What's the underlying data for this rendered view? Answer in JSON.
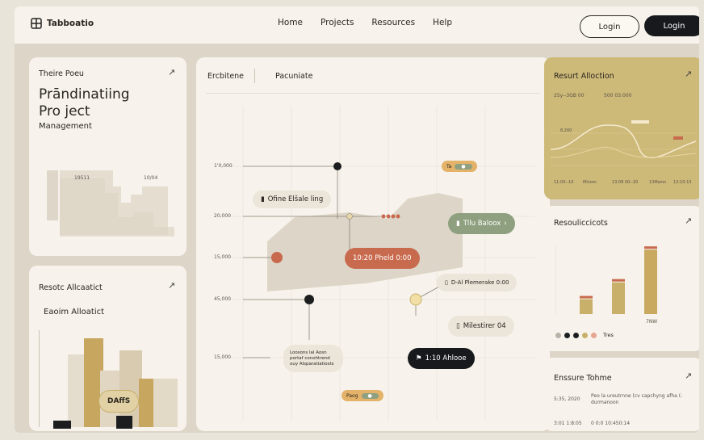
{
  "brand": {
    "name": "Tabboatio",
    "icon": "grid-logo-icon"
  },
  "nav": {
    "items": [
      "Home",
      "Projects",
      "Resources",
      "Help"
    ]
  },
  "auth": {
    "login_outline": "Login",
    "login_solid": "Login"
  },
  "left_top": {
    "title": "Theire Poeu",
    "heading_line1": "Prāndinatiing",
    "heading_line2": "Pro ject",
    "subtitle": "Management",
    "mini_label_1": "19511",
    "mini_label_2": "10/04"
  },
  "left_bottom": {
    "title": "Resotc Allcaatict",
    "subtitle": "Eaoim Alloatict",
    "button_label": "DAffS"
  },
  "center": {
    "tab_1": "Ercbitene",
    "tab_2": "Pacuniate",
    "y_labels": [
      "1'0,000",
      "20,000",
      "15,000",
      "45,000",
      "15,000"
    ],
    "pill_offline": "Ofine Elšale ling",
    "pill_main": "10:20 Pheld 0:00",
    "pill_green": "Tllu Baloox",
    "pill_dark": "1:10 Ahlooe",
    "pill_milestone": "Milestirer 04",
    "note_line1": "D-Al Plemerake 0:00",
    "small_note": "Loosons  lal  Aosn  portaf conohtrend  ouy Alsparatiatiosts",
    "tag_top": "Ta",
    "tag_bottom": "Paog"
  },
  "right_top": {
    "title": "Resurt Alloction",
    "stat_1": "25y--3GB 00",
    "stat_2": "500 03:000",
    "axis_labels": [
      "8.200",
      "11:00--10",
      "Mlnom",
      "13:08 00--20",
      "13Mzmn",
      "13:10-13"
    ]
  },
  "right_mid": {
    "title": "Resouliccicots",
    "legend": "Tres",
    "bar_values": [
      15,
      32,
      65
    ],
    "bar_label": "7NW"
  },
  "right_bottom": {
    "title": "Enssure Tohme",
    "row1_date": "5:35, 2020",
    "row1_text": "Peo la ureutrnne  (cv capchyng  afha  (-durmanoon",
    "row2_date": "3:01 1:8:05",
    "row2_text": "0 0:0  10:450:14"
  },
  "colors": {
    "accent_orange": "#c86a4d",
    "accent_green": "#8ea07f",
    "accent_gold": "#c9b06a",
    "dark": "#17191c",
    "panel": "#f7f3ec"
  }
}
